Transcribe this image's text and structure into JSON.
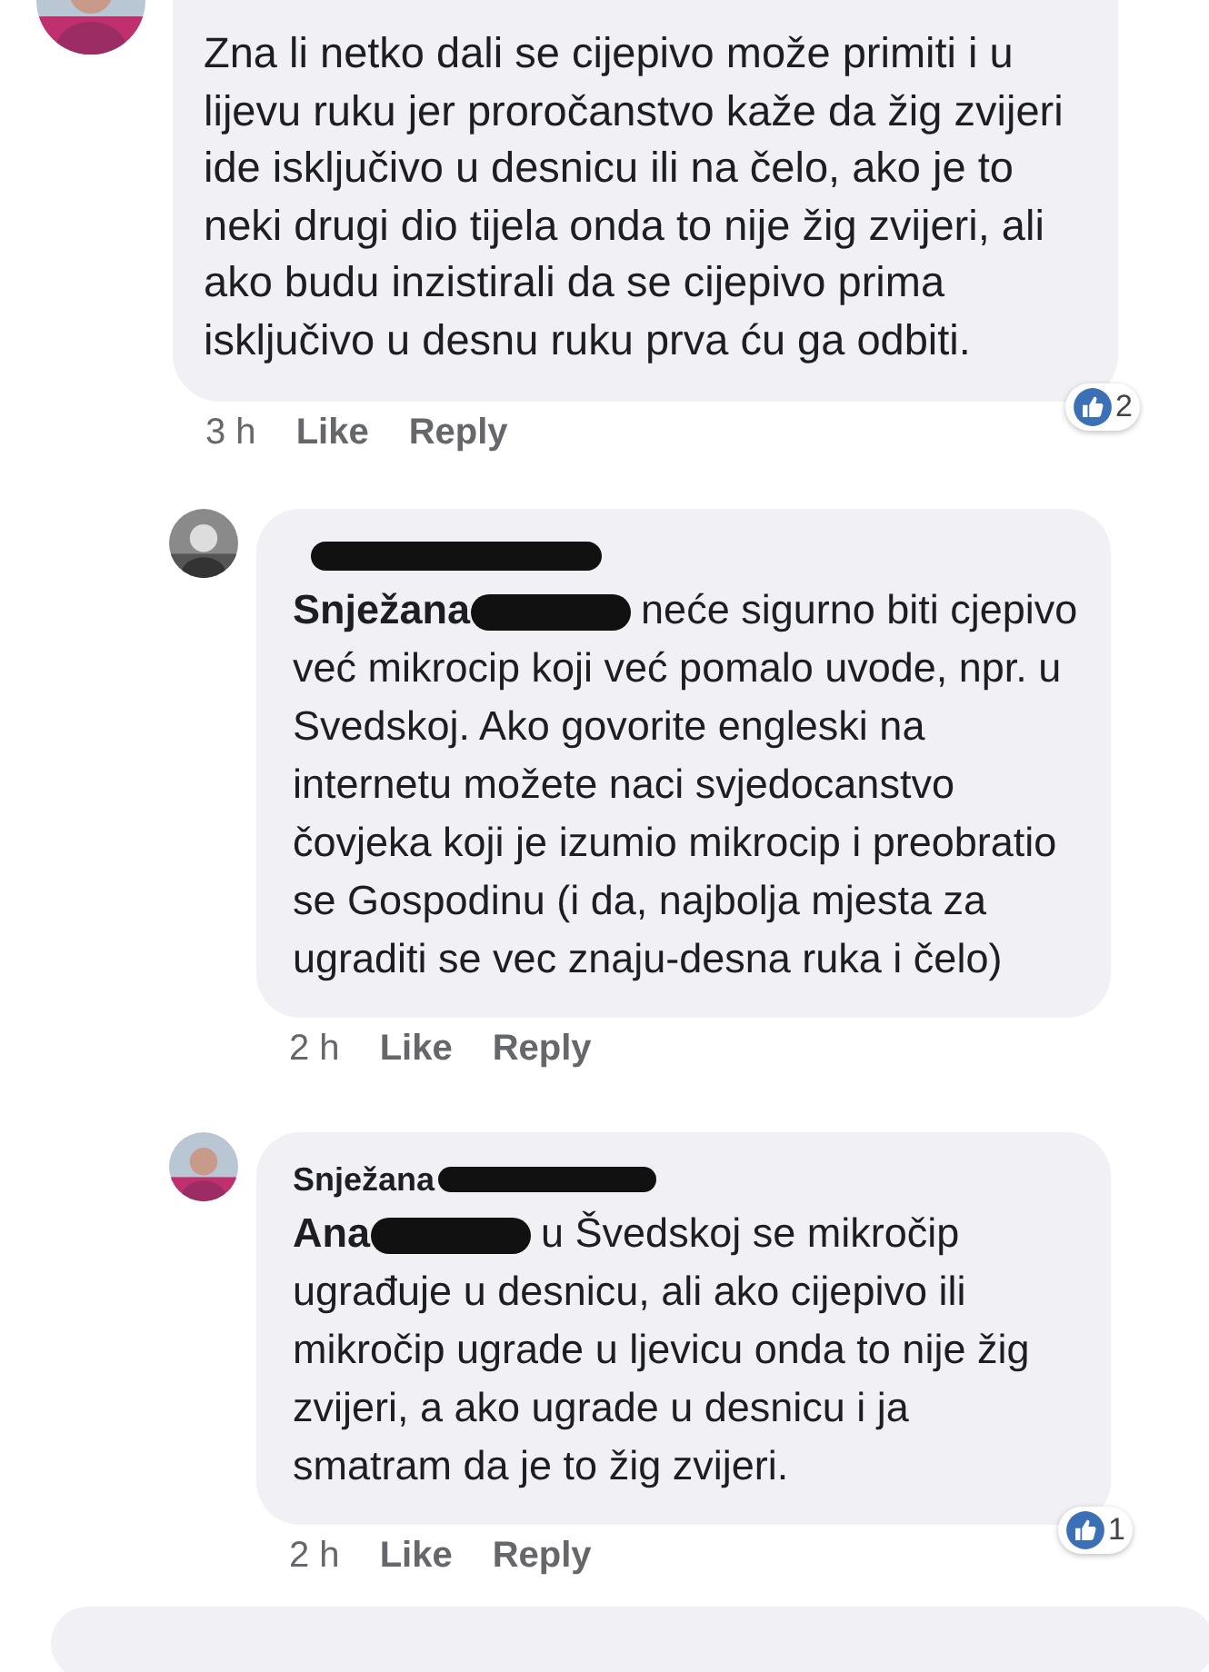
{
  "comments": [
    {
      "text": "Zna li netko dali se cijepivo može primiti i u lijevu ruku jer proročanstvo kaže da žig zvijeri ide isključivo u desnicu ili na čelo, ako je to neki drugi dio tijela onda to nije žig zvijeri, ali ako budu inzistirali da se cijepivo prima isključivo u desnu ruku prva ću ga odbiti.",
      "time": "3 h",
      "like": "Like",
      "reply": "Reply",
      "reactions": "2",
      "reply_level": false
    },
    {
      "author_redacted": true,
      "mention": {
        "name": "Snježana",
        "redacted": true
      },
      "text": "neće sigurno biti cjepivo već mikrocip koji već pomalo uvode, npr. u Svedskoj. Ako govorite engleski na internetu možete naci svjedocanstvo čovjeka koji je izumio mikrocip i preobratio se Gospodinu (i da, najbolja mjesta za ugraditi se vec znaju-desna ruka i čelo)",
      "time": "2 h",
      "like": "Like",
      "reply": "Reply",
      "reply_level": true
    },
    {
      "author": "Snježana",
      "author_redacted": true,
      "mention": {
        "name": "Ana",
        "redacted": true
      },
      "text": "u Švedskoj se mikročip ugrađuje u desnicu, ali ako cijepivo ili mikročip ugrade u ljevicu onda to nije žig zvijeri, a ako ugrade u desnicu i ja smatram da je to žig zvijeri.",
      "time": "2 h",
      "like": "Like",
      "reply": "Reply",
      "reactions": "1",
      "reply_level": true
    }
  ]
}
